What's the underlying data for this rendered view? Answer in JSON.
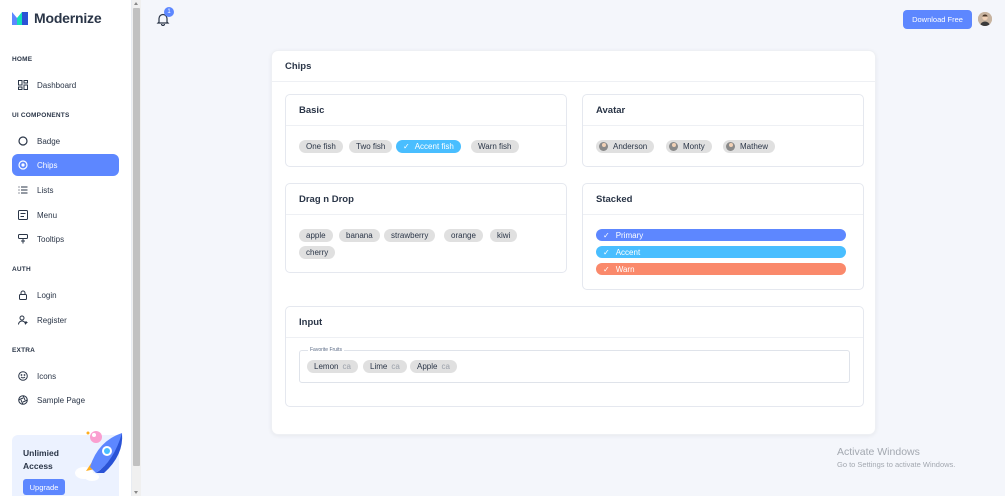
{
  "brand": {
    "name": "Modernize"
  },
  "sidebar": {
    "sections": [
      {
        "label": "HOME"
      },
      {
        "label": "UI COMPONENTS"
      },
      {
        "label": "AUTH"
      },
      {
        "label": "EXTRA"
      }
    ],
    "items": [
      {
        "label": "Dashboard",
        "icon": "dashboard-icon"
      },
      {
        "label": "Badge",
        "icon": "circle-icon"
      },
      {
        "label": "Chips",
        "icon": "chips-icon",
        "active": true
      },
      {
        "label": "Lists",
        "icon": "list-icon"
      },
      {
        "label": "Menu",
        "icon": "menu-icon"
      },
      {
        "label": "Tooltips",
        "icon": "tooltip-icon"
      },
      {
        "label": "Login",
        "icon": "lock-icon"
      },
      {
        "label": "Register",
        "icon": "user-plus-icon"
      },
      {
        "label": "Icons",
        "icon": "mood-icon"
      },
      {
        "label": "Sample Page",
        "icon": "aperture-icon"
      }
    ],
    "promo": {
      "text": "Unlimied Access",
      "button": "Upgrade"
    }
  },
  "header": {
    "notification_count": "1",
    "download_label": "Download Free"
  },
  "page": {
    "title": "Chips",
    "basic": {
      "title": "Basic",
      "chips": [
        "One fish",
        "Two fish",
        "Accent fish",
        "Warn fish"
      ],
      "selected": "Accent fish"
    },
    "avatar": {
      "title": "Avatar",
      "chips": [
        "Anderson",
        "Monty",
        "Mathew"
      ]
    },
    "dragdrop": {
      "title": "Drag n Drop",
      "chips": [
        "apple",
        "banana",
        "strawberry",
        "orange",
        "kiwi",
        "cherry"
      ]
    },
    "stacked": {
      "title": "Stacked",
      "chips": [
        {
          "label": "Primary",
          "color": "#5d87ff"
        },
        {
          "label": "Accent",
          "color": "#49beff"
        },
        {
          "label": "Warn",
          "color": "#fa896b"
        }
      ]
    },
    "input": {
      "title": "Input",
      "field_label": "Favorite Fruits",
      "chips": [
        "Lemon",
        "Lime",
        "Apple"
      ],
      "remove_label": "ca"
    }
  },
  "watermark": {
    "line1": "Activate Windows",
    "line2": "Go to Settings to activate Windows."
  },
  "colors": {
    "primary": "#5d87ff",
    "accent": "#49beff",
    "warn": "#fa896b",
    "chip_bg": "#e0e0e0"
  }
}
